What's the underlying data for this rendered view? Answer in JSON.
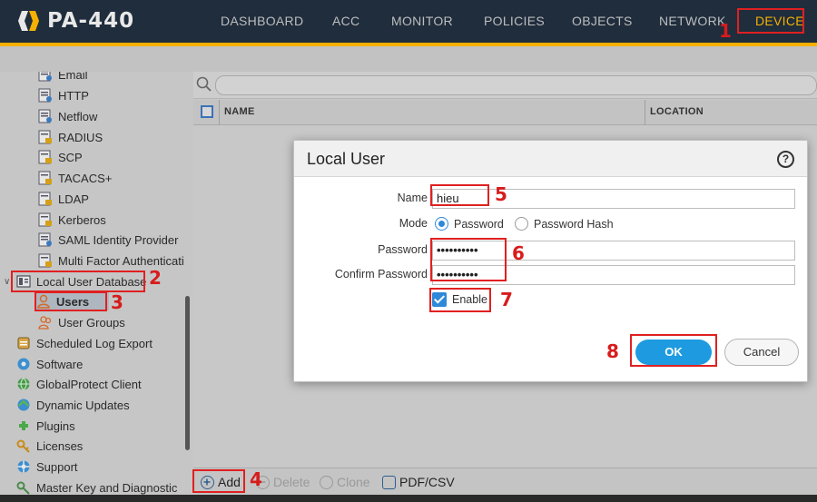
{
  "app": {
    "brand": "PA-440"
  },
  "nav": {
    "items": [
      "DASHBOARD",
      "ACC",
      "MONITOR",
      "POLICIES",
      "OBJECTS",
      "NETWORK",
      "DEVICE"
    ],
    "active": "DEVICE",
    "accent_color": "#f5b000"
  },
  "tree": {
    "items": [
      {
        "label": "Email",
        "icon": "server-profile-icon"
      },
      {
        "label": "HTTP",
        "icon": "server-profile-icon"
      },
      {
        "label": "Netflow",
        "icon": "server-profile-icon"
      },
      {
        "label": "RADIUS",
        "icon": "lock-server-icon"
      },
      {
        "label": "SCP",
        "icon": "lock-server-icon"
      },
      {
        "label": "TACACS+",
        "icon": "lock-server-icon"
      },
      {
        "label": "LDAP",
        "icon": "lock-server-icon"
      },
      {
        "label": "Kerberos",
        "icon": "lock-server-icon"
      },
      {
        "label": "SAML Identity Provider",
        "icon": "server-profile-icon"
      },
      {
        "label": "Multi Factor Authenticati",
        "icon": "lock-server-icon"
      },
      {
        "label": "Local User Database",
        "icon": "database-icon"
      },
      {
        "label": "Users",
        "icon": "user-icon"
      },
      {
        "label": "User Groups",
        "icon": "user-group-icon"
      },
      {
        "label": "Scheduled Log Export",
        "icon": "log-export-icon"
      },
      {
        "label": "Software",
        "icon": "software-icon"
      },
      {
        "label": "GlobalProtect Client",
        "icon": "globe-icon"
      },
      {
        "label": "Dynamic Updates",
        "icon": "globe-update-icon"
      },
      {
        "label": "Plugins",
        "icon": "plugin-icon"
      },
      {
        "label": "Licenses",
        "icon": "key-icon"
      },
      {
        "label": "Support",
        "icon": "support-icon"
      },
      {
        "label": "Master Key and Diagnostic",
        "icon": "master-key-icon"
      }
    ],
    "selected": "Users"
  },
  "table": {
    "columns": [
      "NAME",
      "LOCATION"
    ]
  },
  "footer": {
    "add": "Add",
    "delete": "Delete",
    "clone": "Clone",
    "pdf_csv": "PDF/CSV"
  },
  "dialog": {
    "title": "Local User",
    "help": "?",
    "name_label": "Name",
    "name_value": "hieu",
    "mode_label": "Mode",
    "mode_options": [
      "Password",
      "Password Hash"
    ],
    "mode_selected": "Password",
    "password_label": "Password",
    "password_value": "••••••••••",
    "confirm_label": "Confirm Password",
    "confirm_value": "••••••••••",
    "enable_label": "Enable",
    "enable_checked": true,
    "ok": "OK",
    "cancel": "Cancel"
  },
  "annotations": [
    "1",
    "2",
    "3",
    "4",
    "5",
    "6",
    "7",
    "8"
  ]
}
